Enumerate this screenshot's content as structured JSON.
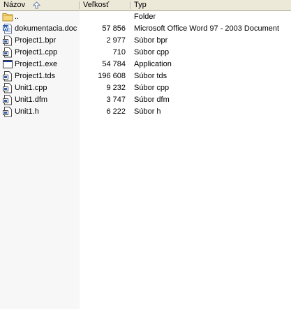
{
  "columns": {
    "name": "Názov",
    "size": "Veľkosť",
    "type": "Typ",
    "sort_icon": "sort-up-arrow-icon"
  },
  "files": [
    {
      "name": "..",
      "size": "",
      "type": "Folder",
      "icon": "folder-up-icon"
    },
    {
      "name": "dokumentacia.doc",
      "size": "57 856",
      "type": "Microsoft Office Word 97 - 2003 Document",
      "icon": "word-document-icon"
    },
    {
      "name": "Project1.bpr",
      "size": "2 977",
      "type": "Súbor bpr",
      "icon": "generic-file-icon"
    },
    {
      "name": "Project1.cpp",
      "size": "710",
      "type": "Súbor cpp",
      "icon": "generic-file-icon"
    },
    {
      "name": "Project1.exe",
      "size": "54 784",
      "type": "Application",
      "icon": "application-window-icon"
    },
    {
      "name": "Project1.tds",
      "size": "196 608",
      "type": "Súbor tds",
      "icon": "generic-file-icon"
    },
    {
      "name": "Unit1.cpp",
      "size": "9 232",
      "type": "Súbor cpp",
      "icon": "generic-file-icon"
    },
    {
      "name": "Unit1.dfm",
      "size": "3 747",
      "type": "Súbor dfm",
      "icon": "generic-file-icon"
    },
    {
      "name": "Unit1.h",
      "size": "6 222",
      "type": "Súbor h",
      "icon": "generic-file-icon"
    }
  ]
}
